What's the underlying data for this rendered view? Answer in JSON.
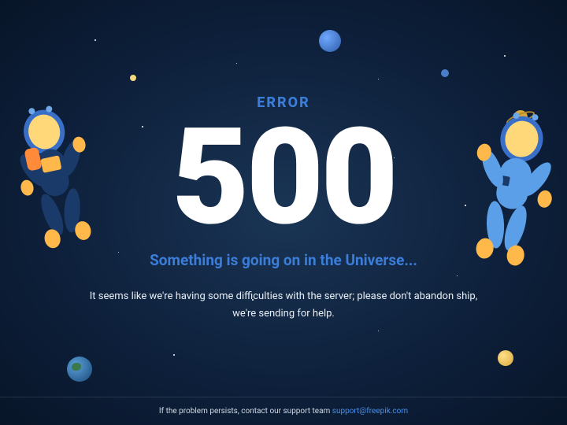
{
  "error": {
    "label": "ERROR",
    "code": "500",
    "subtitle": "Something is going on in the Universe...",
    "description": "It seems like we're having some difficulties with the server; please don't abandon ship, we're sending for help."
  },
  "footer": {
    "text": "If the problem persists, contact our support team ",
    "email": "support@freepik.com"
  }
}
